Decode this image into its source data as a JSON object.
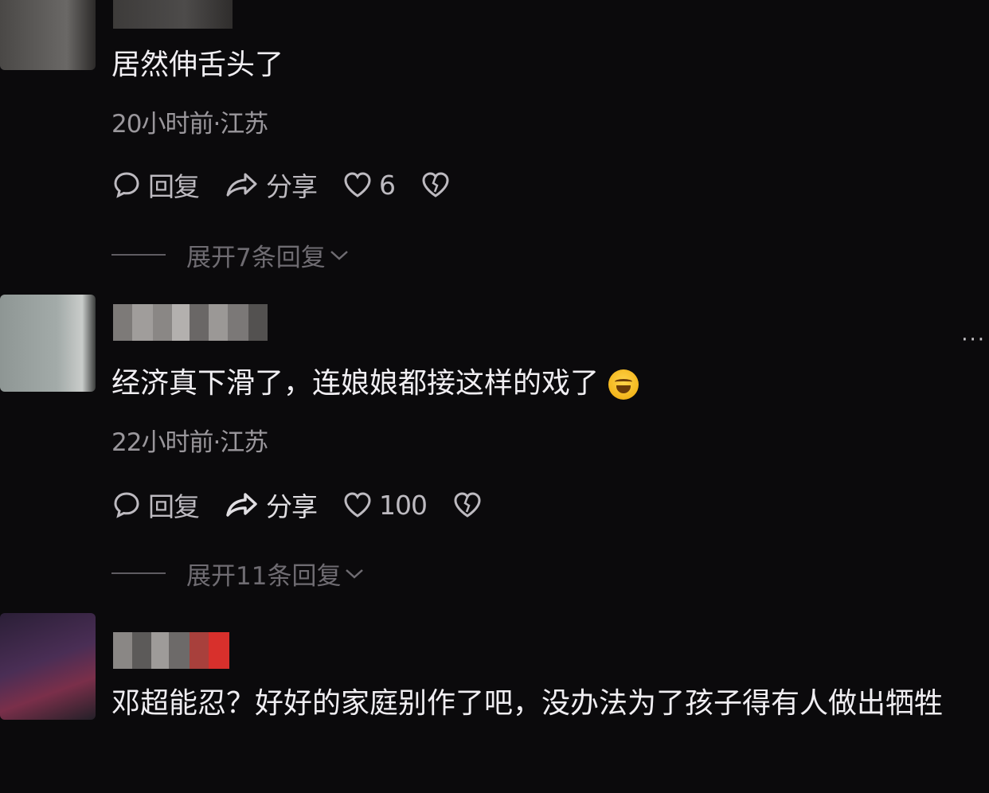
{
  "comments": [
    {
      "text": "居然伸舌头了",
      "meta": "20小时前·江苏",
      "reply_label": "回复",
      "share_label": "分享",
      "like_count": "6",
      "expand_label": "展开7条回复"
    },
    {
      "text": "经济真下滑了，连娘娘都接这样的戏了",
      "meta": "22小时前·江苏",
      "reply_label": "回复",
      "share_label": "分享",
      "like_count": "100",
      "expand_label": "展开11条回复"
    },
    {
      "text": "邓超能忍？好好的家庭别作了吧，没办法为了孩子得有人做出牺牲"
    }
  ],
  "icons": {
    "reply": "comment-bubble-icon",
    "share": "share-arrow-icon",
    "like": "heart-icon",
    "dislike": "broken-heart-icon",
    "expand": "chevron-down-icon",
    "emoji": "crying-laughing-emoji",
    "more": "more-dots-icon"
  },
  "colors": {
    "background": "#0b0a0c",
    "text": "#f0eef2",
    "meta": "#9a979c",
    "action": "#bdbac0",
    "expand": "#6f6c72"
  }
}
